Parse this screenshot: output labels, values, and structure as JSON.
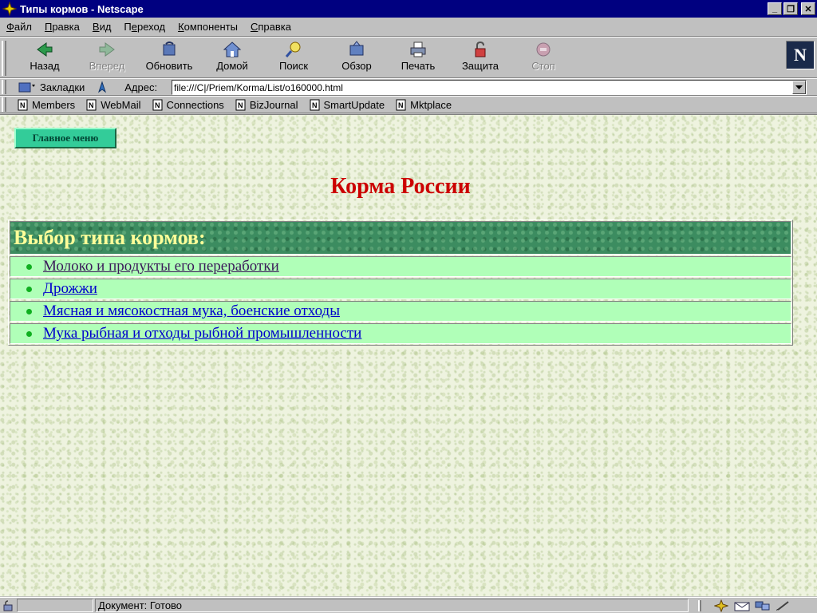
{
  "window": {
    "title": "Типы кормов - Netscape",
    "controls": {
      "minimize": "_",
      "restore": "❐",
      "close": "✕"
    }
  },
  "menu": {
    "items": [
      {
        "pre": "",
        "key": "Ф",
        "post": "айл"
      },
      {
        "pre": "",
        "key": "П",
        "post": "равка"
      },
      {
        "pre": "",
        "key": "В",
        "post": "ид"
      },
      {
        "pre": "П",
        "key": "е",
        "post": "реход"
      },
      {
        "pre": "",
        "key": "К",
        "post": "омпоненты"
      },
      {
        "pre": "",
        "key": "С",
        "post": "правка"
      }
    ]
  },
  "toolbar": {
    "back": "Назад",
    "forward": "Вперед",
    "reload": "Обновить",
    "home": "Домой",
    "search": "Поиск",
    "guide": "Обзор",
    "print": "Печать",
    "security": "Защита",
    "stop": "Стоп",
    "logo": "N"
  },
  "location": {
    "bookmarks_label": "Закладки",
    "address_label": "Адрес:",
    "url": "file:///C|/Priem/Korma/List/o160000.html"
  },
  "personal_toolbar": {
    "items": [
      "Members",
      "WebMail",
      "Connections",
      "BizJournal",
      "SmartUpdate",
      "Mktplace"
    ]
  },
  "page": {
    "main_menu_button": "Главное меню",
    "heading": "Корма России",
    "table_header": "Выбор типа кормов:",
    "feed_types": [
      {
        "label": "Молоко и продукты его переработки",
        "visited": true
      },
      {
        "label": "Дрожжи",
        "visited": false
      },
      {
        "label": "Мясная и мясокостная мука, боенские отходы",
        "visited": false
      },
      {
        "label": "Мука рыбная и отходы рыбной промышленности",
        "visited": false
      }
    ]
  },
  "status": {
    "text": "Документ: Готово"
  },
  "colors": {
    "heading": "#cc0000",
    "header_text": "#ffff99",
    "row_bg": "#b0ffb8",
    "bullet": "#10b020",
    "link": "#0000cc",
    "visited_link": "#3a1a5a"
  }
}
